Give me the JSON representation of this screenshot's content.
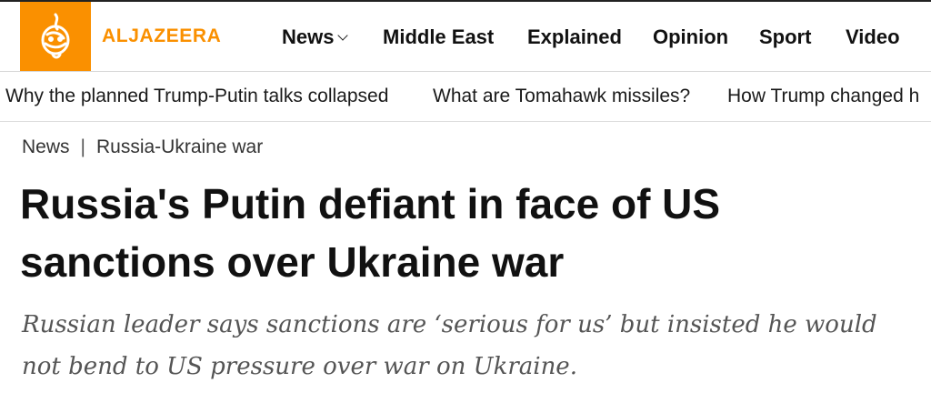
{
  "header": {
    "brand": "ALJAZEERA",
    "brand_color": "#fa9000",
    "logo_icon": "aljazeera-calligraphy-logo",
    "nav": [
      {
        "label": "News",
        "has_dropdown": true
      },
      {
        "label": "Middle East"
      },
      {
        "label": "Explained"
      },
      {
        "label": "Opinion"
      },
      {
        "label": "Sport"
      },
      {
        "label": "Video"
      }
    ]
  },
  "trending": [
    "Why the planned Trump-Putin talks collapsed",
    "What are Tomahawk missiles?",
    "How Trump changed h"
  ],
  "breadcrumb": {
    "section": "News",
    "separator": "|",
    "topic": "Russia-Ukraine war"
  },
  "article": {
    "headline_line1": "Russia's Putin defiant in face of US",
    "headline_line2": "sanctions over Ukraine war",
    "subhead_line1": "Russian leader says sanctions are ‘serious for us’ but insisted he would",
    "subhead_line2": "not bend to US pressure over war on Ukraine."
  }
}
